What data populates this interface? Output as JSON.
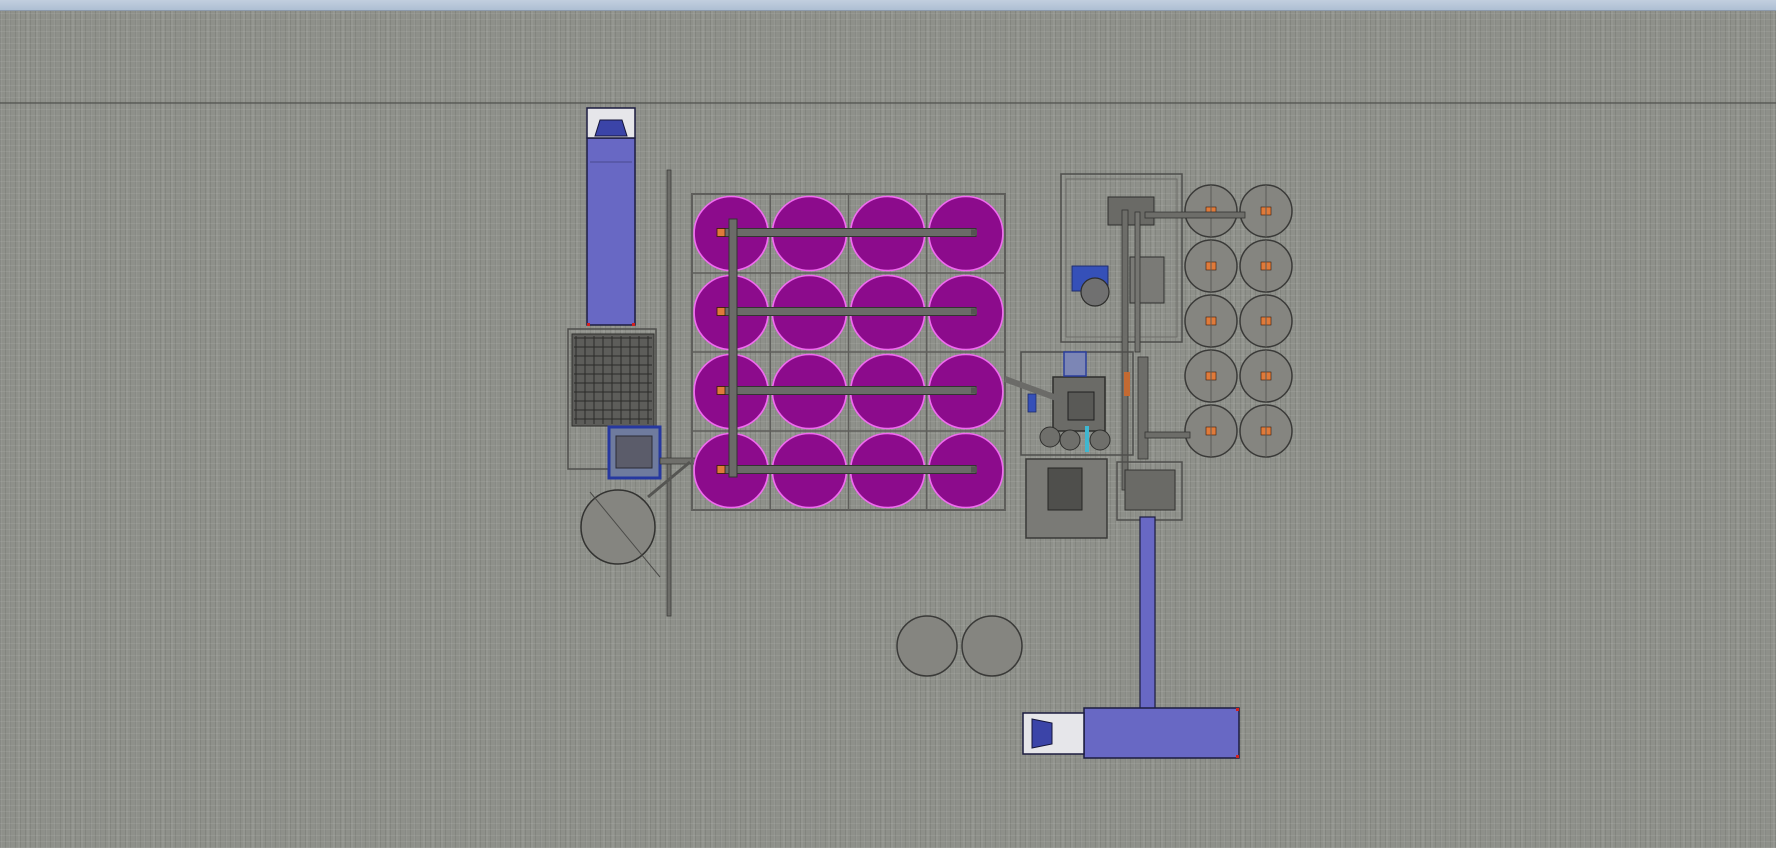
{
  "app": {
    "title_visible": false
  },
  "colors": {
    "floor": "#8e908a",
    "frame": "#5f5f5c",
    "tank_fill": "#8c0b8c",
    "tank_rim": "#f06cf0",
    "truck_body": "#6868c4",
    "truck_cab": "#3b44a8",
    "machine_blue": "#3550b8",
    "grey_tank": "#858580",
    "heater_orange": "#e07a3a",
    "corner_red": "#d02020"
  },
  "scene": {
    "magenta_tank_rows": 4,
    "magenta_tank_cols": 4,
    "small_tank_rows": 5,
    "small_tank_cols": 2,
    "bottom_grey_tanks": 2,
    "trucks": [
      "top-left-truck",
      "bottom-truck"
    ]
  },
  "icons": {
    "truck_cab": "truck-cab-icon",
    "conveyor": "conveyor-icon"
  }
}
